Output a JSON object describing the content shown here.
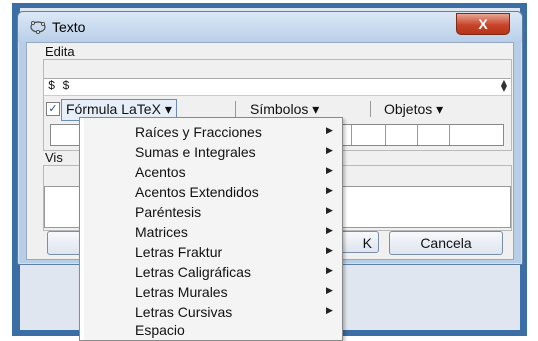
{
  "window": {
    "title": "Texto",
    "close_glyph": "X"
  },
  "edit": {
    "label": "Edita",
    "value": "$ $",
    "spin_up": "▲",
    "spin_down": "▼"
  },
  "toolbar": {
    "checkbox_mark": "✓",
    "latex_label": "Fórmula LaTeX ▾",
    "symbols_label": "Símbolos ▾",
    "objects_label": "Objetos ▾"
  },
  "preview": {
    "label": "Vis"
  },
  "buttons": {
    "partial_label": "K",
    "cancel_label": "Cancela"
  },
  "menu": {
    "items": [
      {
        "label": "Raíces y Fracciones",
        "arrow": "▶"
      },
      {
        "label": "Sumas e Integrales",
        "arrow": "▶"
      },
      {
        "label": "Acentos",
        "arrow": "▶"
      },
      {
        "label": "Acentos Extendidos",
        "arrow": "▶"
      },
      {
        "label": "Paréntesis",
        "arrow": "▶"
      },
      {
        "label": "Matrices",
        "arrow": "▶"
      },
      {
        "label": "Letras Fraktur",
        "arrow": "▶"
      },
      {
        "label": "Letras Caligráficas",
        "arrow": "▶"
      },
      {
        "label": "Letras Murales",
        "arrow": "▶"
      },
      {
        "label": "Letras Cursivas",
        "arrow": "▶"
      },
      {
        "label": "Espacio",
        "arrow": ""
      }
    ]
  },
  "colors": {
    "frame": "#3a6ea5",
    "titlebar": "#b9cfe8",
    "close": "#c7452a",
    "menu_bg": "#f4f4f4"
  }
}
